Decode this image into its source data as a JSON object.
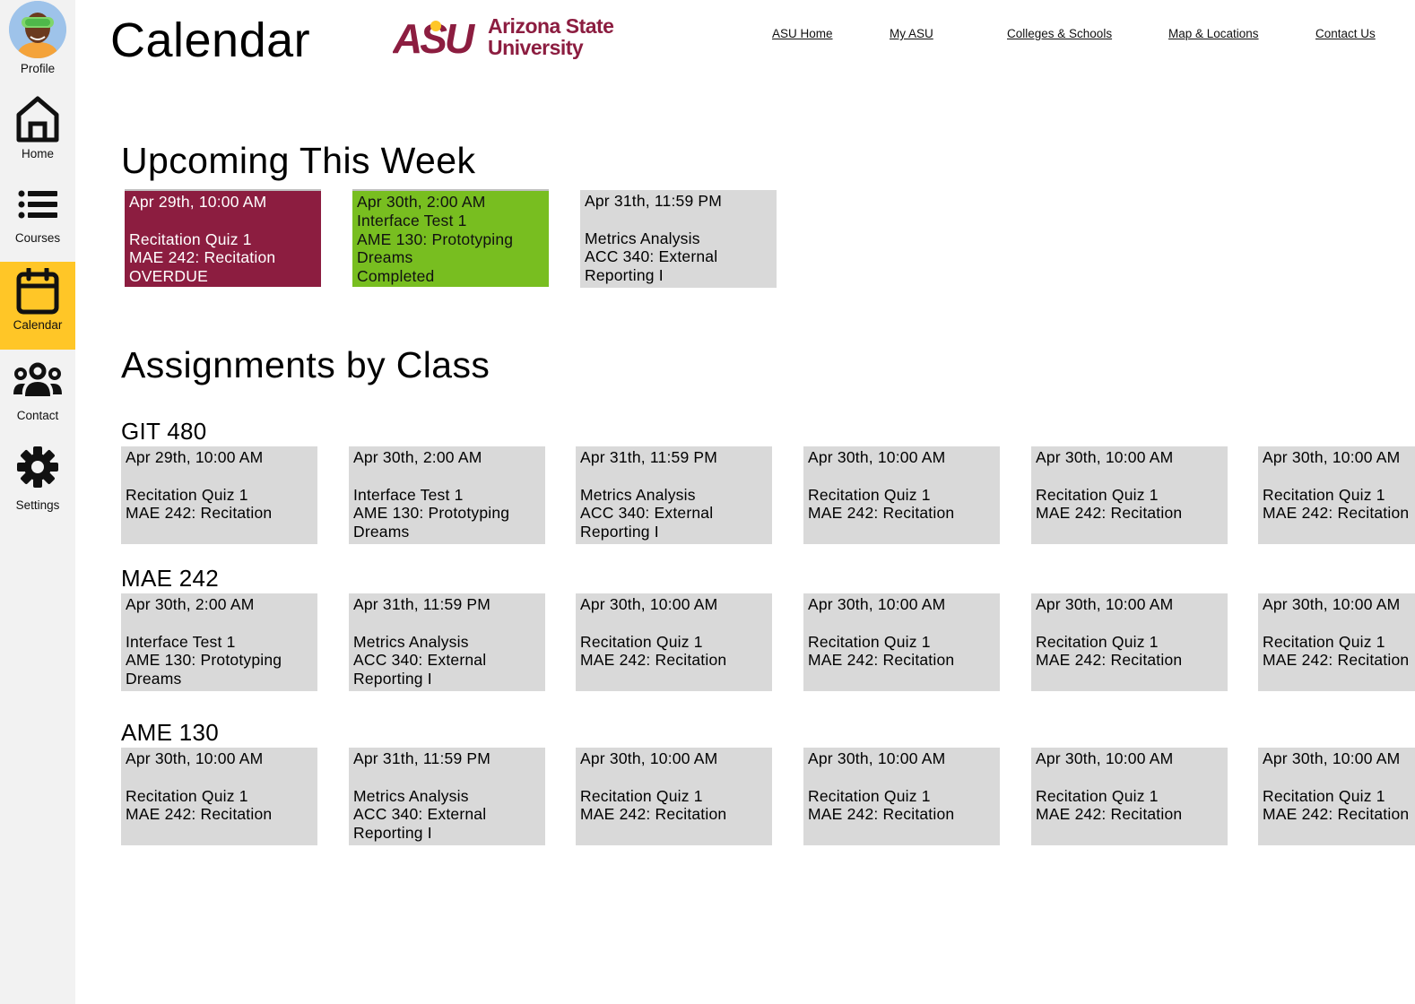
{
  "sidebar": {
    "items": [
      {
        "label": "Profile",
        "icon": "avatar"
      },
      {
        "label": "Home",
        "icon": "home-icon"
      },
      {
        "label": "Courses",
        "icon": "list-icon"
      },
      {
        "label": "Calendar",
        "icon": "calendar-icon",
        "active": true
      },
      {
        "label": "Contact",
        "icon": "people-icon"
      },
      {
        "label": "Settings",
        "icon": "gear-icon"
      }
    ],
    "active_color": "#ffc627"
  },
  "header": {
    "title": "Calendar",
    "logo": {
      "mark": "ASU",
      "line1": "Arizona State",
      "line2": "University",
      "color": "#8c1d40",
      "accent": "#ffc627"
    },
    "nav": [
      "ASU Home",
      "My ASU",
      "Colleges & Schools",
      "Map & Locations",
      "Contact Us"
    ]
  },
  "upcoming": {
    "title": "Upcoming This Week",
    "cards": [
      {
        "date": "Apr 29th, 10:00 AM",
        "status_line": "",
        "lines": [
          "Recitation Quiz 1",
          "MAE 242: Recitation",
          "OVERDUE"
        ],
        "status": "overdue"
      },
      {
        "date": "Apr 30th, 2:00 AM",
        "lines": [
          "Interface Test 1",
          "AME 130: Prototyping",
          "Dreams",
          "Completed"
        ],
        "status": "completed"
      },
      {
        "date": "Apr 31th, 11:59 PM",
        "lines": [
          "",
          "Metrics Analysis",
          "ACC 340: External",
          "Reporting I"
        ],
        "status": "pending"
      }
    ]
  },
  "assignments": {
    "title": "Assignments by Class",
    "classes": [
      {
        "name": "GIT 480",
        "cards": [
          {
            "date": "Apr 29th, 10:00 AM",
            "lines": [
              "Recitation Quiz 1",
              "MAE 242: Recitation"
            ]
          },
          {
            "date": "Apr 30th, 2:00 AM",
            "lines": [
              "Interface Test 1",
              "AME 130: Prototyping",
              "Dreams"
            ]
          },
          {
            "date": "Apr 31th, 11:59 PM",
            "lines": [
              "Metrics Analysis",
              "ACC 340: External",
              "Reporting I"
            ]
          },
          {
            "date": "Apr 30th, 10:00 AM",
            "lines": [
              "Recitation Quiz 1",
              "MAE 242: Recitation"
            ]
          },
          {
            "date": "Apr 30th, 10:00 AM",
            "lines": [
              "Recitation Quiz 1",
              "MAE 242: Recitation"
            ]
          },
          {
            "date": "Apr 30th, 10:00 AM",
            "lines": [
              "Recitation Quiz 1",
              "MAE 242: Recitation"
            ]
          }
        ]
      },
      {
        "name": "MAE 242",
        "cards": [
          {
            "date": "Apr 30th, 2:00 AM",
            "lines": [
              "Interface Test 1",
              "AME 130: Prototyping",
              "Dreams"
            ]
          },
          {
            "date": "Apr 31th, 11:59 PM",
            "lines": [
              "Metrics Analysis",
              "ACC 340: External",
              "Reporting I"
            ]
          },
          {
            "date": "Apr 30th, 10:00 AM",
            "lines": [
              "Recitation Quiz 1",
              "MAE 242: Recitation"
            ]
          },
          {
            "date": "Apr 30th, 10:00 AM",
            "lines": [
              "Recitation Quiz 1",
              "MAE 242: Recitation"
            ]
          },
          {
            "date": "Apr 30th, 10:00 AM",
            "lines": [
              "Recitation Quiz 1",
              "MAE 242: Recitation"
            ]
          },
          {
            "date": "Apr 30th, 10:00 AM",
            "lines": [
              "Recitation Quiz 1",
              "MAE 242: Recitation"
            ]
          }
        ]
      },
      {
        "name": "AME 130",
        "cards": [
          {
            "date": "Apr 30th, 10:00 AM",
            "lines": [
              "Recitation Quiz 1",
              "MAE 242: Recitation"
            ]
          },
          {
            "date": "Apr 31th, 11:59 PM",
            "lines": [
              "Metrics Analysis",
              "ACC 340: External",
              "Reporting I"
            ]
          },
          {
            "date": "Apr 30th, 10:00 AM",
            "lines": [
              "Recitation Quiz 1",
              "MAE 242: Recitation"
            ]
          },
          {
            "date": "Apr 30th, 10:00 AM",
            "lines": [
              "Recitation Quiz 1",
              "MAE 242: Recitation"
            ]
          },
          {
            "date": "Apr 30th, 10:00 AM",
            "lines": [
              "Recitation Quiz 1",
              "MAE 242: Recitation"
            ]
          },
          {
            "date": "Apr 30th, 10:00 AM",
            "lines": [
              "Recitation Quiz 1",
              "MAE 242: Recitation"
            ]
          }
        ]
      }
    ]
  },
  "colors": {
    "overdue": "#8c1d40",
    "completed": "#78be20",
    "card": "#d9d9d9",
    "sidebar": "#f2f2f2"
  }
}
